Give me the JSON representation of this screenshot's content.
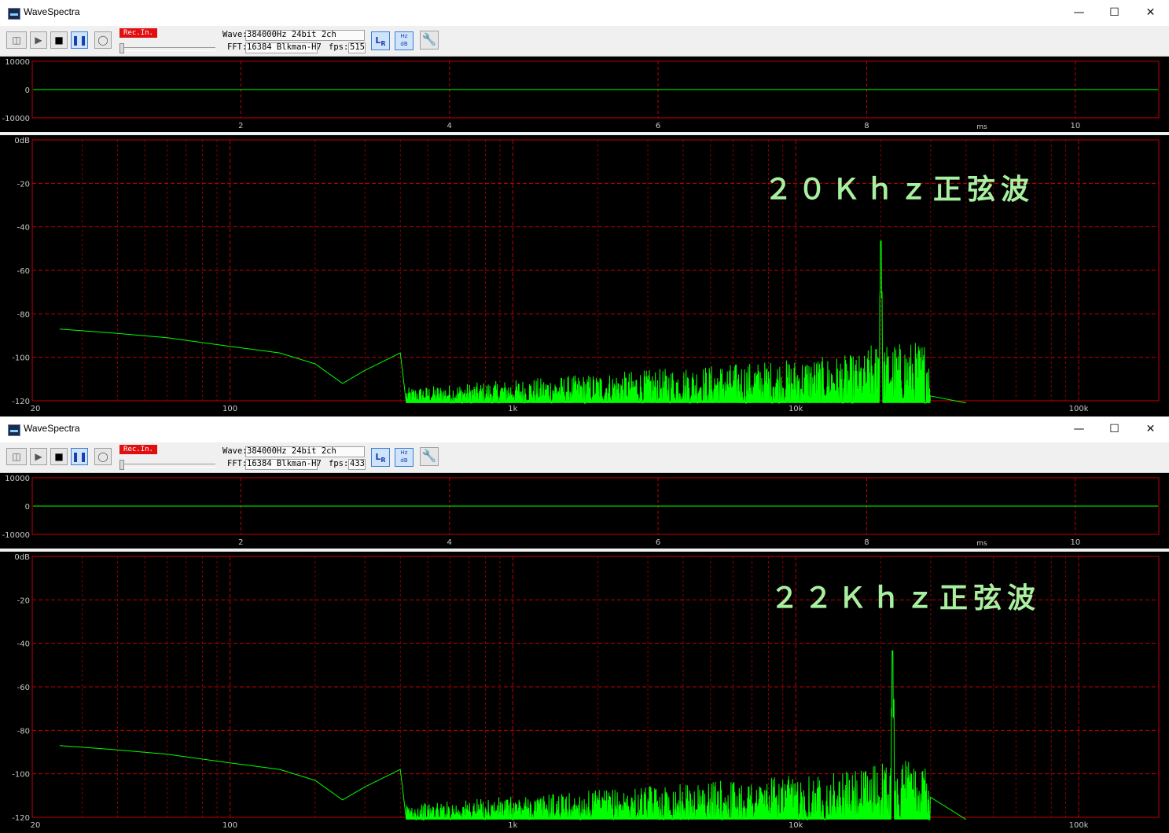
{
  "windows": [
    {
      "title": "WaveSpectra",
      "rec_label": "Rec.In.",
      "wave_label": "Wave:",
      "wave_value": "384000Hz 24bit 2ch",
      "fft_label": "FFT:",
      "fft_value": "16384 Blkman-H7",
      "fps_label": "fps:",
      "fps_value": "515",
      "annotation": "２０Ｋｈｚ正弦波",
      "peak_freq_hz": 20000,
      "peak_db": -48
    },
    {
      "title": "WaveSpectra",
      "rec_label": "Rec.In.",
      "wave_label": "Wave:",
      "wave_value": "384000Hz 24bit 2ch",
      "fft_label": "FFT:",
      "fft_value": "16384 Blkman-H7",
      "fps_label": "fps:",
      "fps_value": "433",
      "annotation": "２２Ｋｈｚ正弦波",
      "peak_freq_hz": 22000,
      "peak_db": -46
    }
  ],
  "toolbar_icons": [
    "open-icon",
    "play-icon",
    "stop-icon",
    "pause-icon",
    "record-icon",
    "lr-icon",
    "hz-db-icon",
    "settings-icon"
  ],
  "colors": {
    "trace": "#00ff00",
    "grid": "#c00000",
    "background": "#000000",
    "label": "#a8f0a0"
  },
  "chart_data": [
    {
      "type": "line",
      "name": "waveform",
      "y_ticks": [
        "10000",
        "0",
        "-10000"
      ],
      "x_ticks": [
        "2",
        "4",
        "6",
        "8",
        "10"
      ],
      "xlabel": "ms",
      "xlim": [
        0,
        10.8
      ],
      "ylim": [
        -10000,
        10000
      ],
      "series": [
        {
          "values": [
            0,
            0
          ]
        }
      ]
    },
    {
      "type": "line",
      "name": "spectrum",
      "y_ticks": [
        "0dB",
        "-20",
        "-40",
        "-60",
        "-80",
        "-100",
        "-120"
      ],
      "x_ticks": [
        "20",
        "100",
        "1k",
        "10k",
        "100k"
      ],
      "x_scale": "log",
      "xlim": [
        20,
        192000
      ],
      "ylim": [
        -120,
        0
      ],
      "baseline_points": {
        "x": [
          25,
          40,
          60,
          100,
          150,
          200,
          250,
          300,
          400
        ],
        "y": [
          -87,
          -89,
          -91,
          -95,
          -98,
          -103,
          -112,
          -106,
          -98
        ]
      }
    }
  ]
}
